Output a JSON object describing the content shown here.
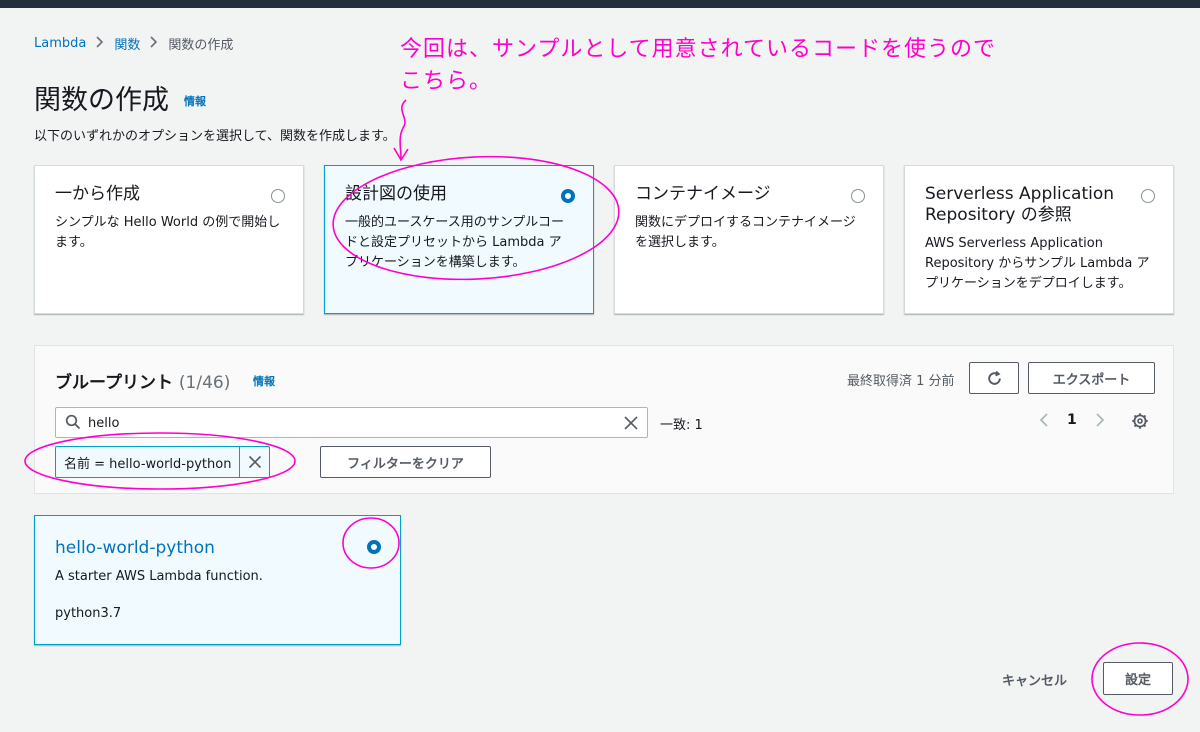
{
  "breadcrumb": {
    "items": [
      "Lambda",
      "関数"
    ],
    "current": "関数の作成"
  },
  "page": {
    "title": "関数の作成",
    "info_label": "情報",
    "description": "以下のいずれかのオプションを選択して、関数を作成します。"
  },
  "options": [
    {
      "title": "一から作成",
      "description": "シンプルな Hello World の例で開始します。",
      "selected": false
    },
    {
      "title": "設計図の使用",
      "description": "一般的ユースケース用のサンプルコードと設定プリセットから Lambda アプリケーションを構築します。",
      "selected": true
    },
    {
      "title": "コンテナイメージ",
      "description": "関数にデプロイするコンテナイメージを選択します。",
      "selected": false
    },
    {
      "title": "Serverless Application Repository の参照",
      "description": "AWS Serverless Application Repository からサンプル Lambda アプリケーションをデプロイします。",
      "selected": false
    }
  ],
  "blueprints": {
    "title": "ブループリント",
    "count": "(1/46)",
    "info_label": "情報",
    "last_fetched": "最終取得済 1 分前",
    "export_label": "エクスポート",
    "search_value": "hello",
    "match_text": "一致: 1",
    "page_number": "1",
    "filter_token": "名前 = hello-world-python",
    "clear_filters_label": "フィルターをクリア"
  },
  "result_card": {
    "title": "hello-world-python",
    "description": "A starter AWS Lambda function.",
    "runtime": "python3.7",
    "selected": true
  },
  "footer": {
    "cancel_label": "キャンセル",
    "configure_label": "設定"
  },
  "annotation": {
    "line1": "今回は、サンプルとして用意されているコードを使うので",
    "line2": "こちら。",
    "color": "#ff00cc"
  },
  "colors": {
    "link": "#0073bb",
    "selected_bg": "#f1faff",
    "selected_border": "#00a1c9"
  },
  "icons": [
    "chevron-right-icon",
    "search-icon",
    "close-icon",
    "refresh-icon",
    "chevron-left-icon",
    "gear-icon"
  ]
}
